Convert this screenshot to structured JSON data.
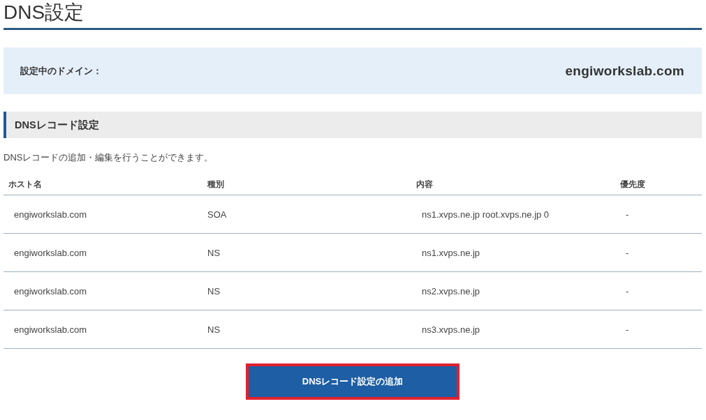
{
  "page_title": "DNS設定",
  "domain": {
    "label": "設定中のドメイン：",
    "value": "engiworkslab.com"
  },
  "section": {
    "title": "DNSレコード設定",
    "description": "DNSレコードの追加・編集を行うことができます。"
  },
  "table": {
    "columns": [
      "ホスト名",
      "種別",
      "内容",
      "優先度"
    ],
    "rows": [
      [
        "engiworkslab.com",
        "SOA",
        "ns1.xvps.ne.jp root.xvps.ne.jp 0",
        "-"
      ],
      [
        "engiworkslab.com",
        "NS",
        "ns1.xvps.ne.jp",
        "-"
      ],
      [
        "engiworkslab.com",
        "NS",
        "ns2.xvps.ne.jp",
        "-"
      ],
      [
        "engiworkslab.com",
        "NS",
        "ns3.xvps.ne.jp",
        "-"
      ]
    ]
  },
  "add_button": {
    "label": "DNSレコード設定の追加",
    "highlighted": true
  }
}
